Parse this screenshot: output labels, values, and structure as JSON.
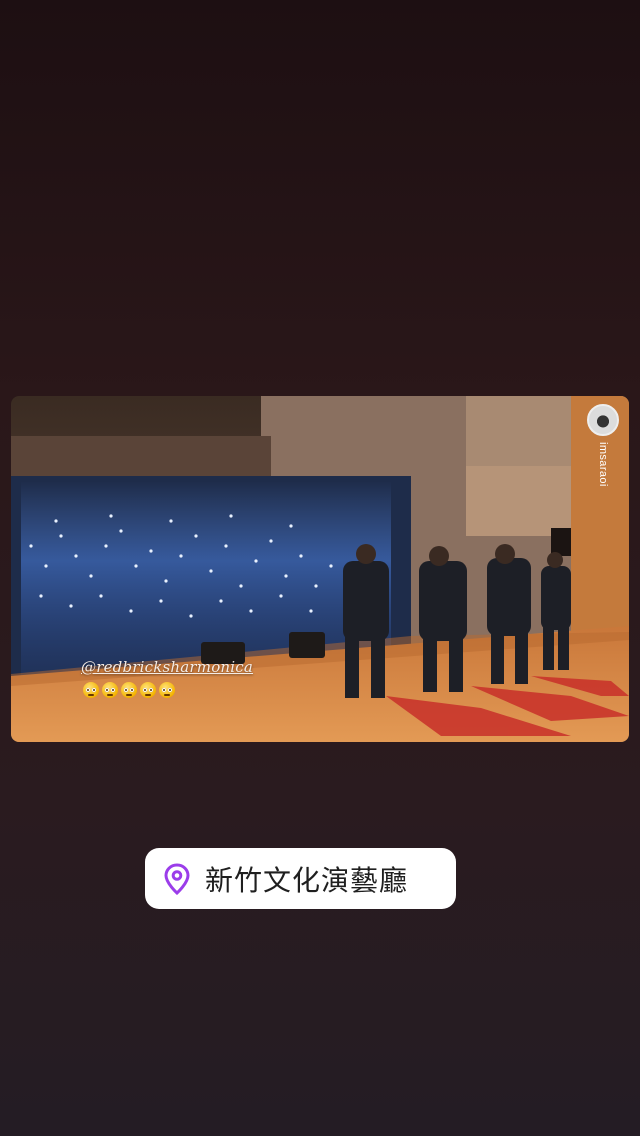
{
  "story": {
    "mention": "@redbricksharmonica",
    "emojis": [
      "pleading-face",
      "pleading-face",
      "pleading-face",
      "pleading-face",
      "pleading-face"
    ],
    "credit_username": "imsaraoi"
  },
  "location_sticker": {
    "icon": "location-pin-icon",
    "name": "新竹文化演藝廳",
    "accent": "#9b3dea"
  },
  "colors": {
    "stage_floor": "#d9853f",
    "stage_light": "#c8302a",
    "audience_light": "#4a7fe0"
  }
}
